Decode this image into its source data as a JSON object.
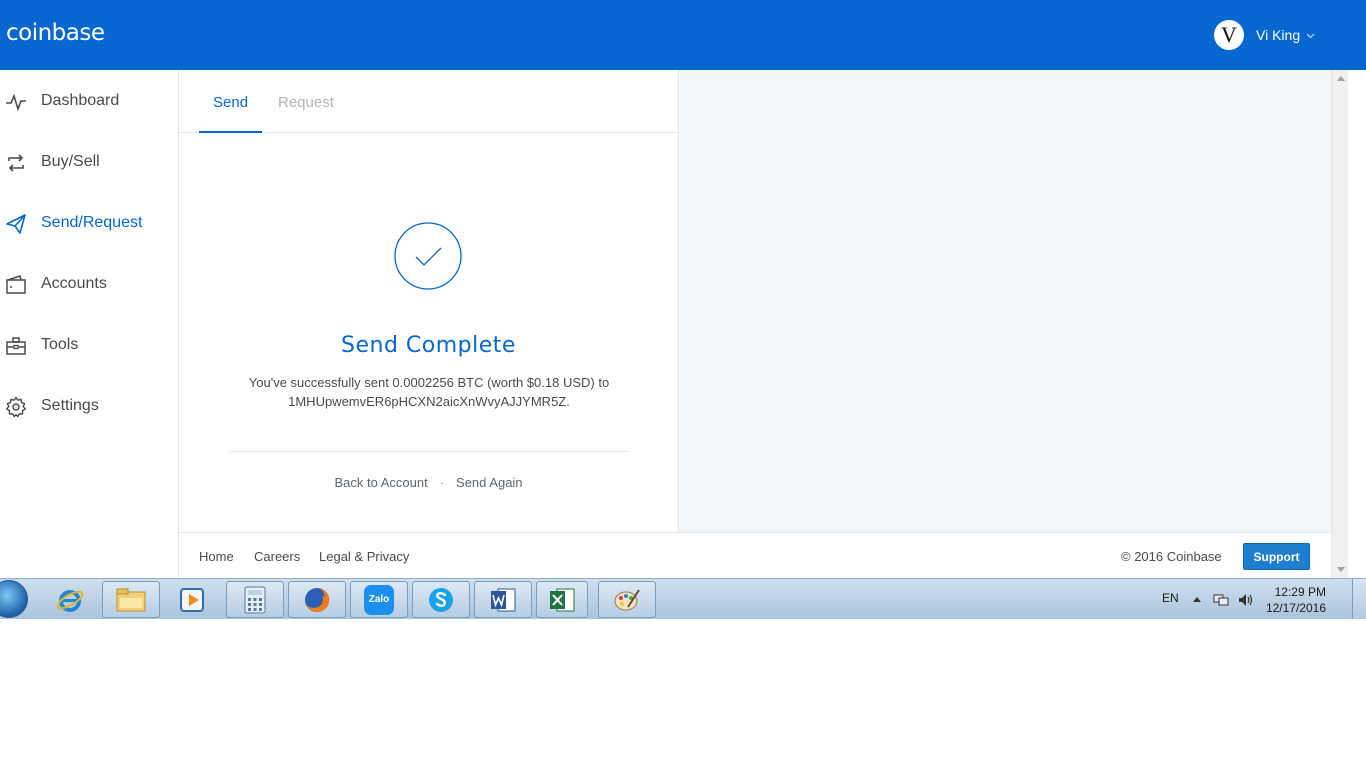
{
  "header": {
    "logo": "coinbase",
    "user": {
      "avatar_letter": "V",
      "name": "Vi King"
    }
  },
  "sidebar": {
    "items": [
      {
        "label": "Dashboard",
        "icon": "pulse-icon",
        "active": false
      },
      {
        "label": "Buy/Sell",
        "icon": "exchange-arrows-icon",
        "active": false
      },
      {
        "label": "Send/Request",
        "icon": "paper-plane-icon",
        "active": true
      },
      {
        "label": "Accounts",
        "icon": "wallet-icon",
        "active": false
      },
      {
        "label": "Tools",
        "icon": "toolbox-icon",
        "active": false
      },
      {
        "label": "Settings",
        "icon": "gear-icon",
        "active": false
      }
    ]
  },
  "panel": {
    "tabs": [
      {
        "label": "Send",
        "active": true
      },
      {
        "label": "Request",
        "active": false
      }
    ],
    "status_icon": "checkmark-circle-icon",
    "title": "Send Complete",
    "message_line1": "You've successfully sent 0.0002256 BTC (worth $0.18 USD) to",
    "message_line2": "1MHUpwemvER6pHCXN2aicXnWvyAJJYMR5Z.",
    "actions": {
      "back": "Back to Account",
      "separator": "·",
      "again": "Send Again"
    }
  },
  "footer": {
    "links": [
      "Home",
      "Careers",
      "Legal & Privacy"
    ],
    "copyright": "© 2016 Coinbase",
    "support": "Support"
  },
  "taskbar": {
    "apps": [
      "internet-explorer-icon",
      "file-explorer-icon",
      "media-player-icon",
      "calculator-icon",
      "firefox-icon",
      "zalo-icon",
      "skype-icon",
      "word-icon",
      "excel-icon",
      "paint-icon"
    ],
    "zalo_label": "Zalo",
    "tray": {
      "language": "EN",
      "time": "12:29 PM",
      "date": "12/17/2016"
    }
  },
  "colors": {
    "brand_blue": "#0667d0",
    "support_button": "#1f7ed0",
    "panel_background": "#f4f7fa"
  }
}
